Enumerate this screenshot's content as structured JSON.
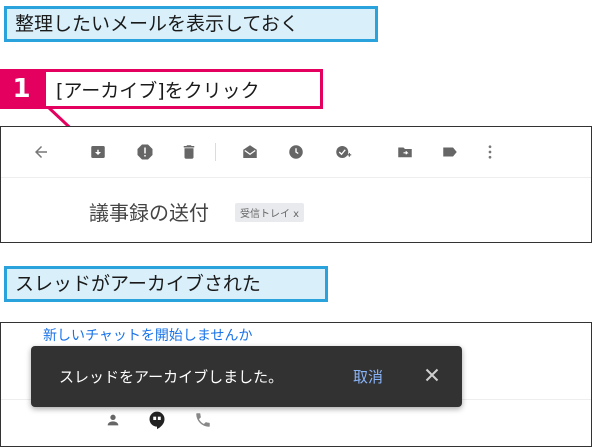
{
  "section1": {
    "heading": "整理したいメールを表示しておく"
  },
  "step": {
    "number": "1",
    "instruction": "[アーカイブ]をクリック"
  },
  "toolbar": {
    "icons": [
      "back-arrow-icon",
      "archive-icon",
      "report-spam-icon",
      "delete-icon",
      "mark-unread-icon",
      "snooze-icon",
      "add-to-tasks-icon",
      "move-to-icon",
      "labels-icon",
      "more-options-icon"
    ]
  },
  "email": {
    "subject": "議事録の送付",
    "label_chip": "受信トレイ x"
  },
  "section2": {
    "heading": "スレッドがアーカイブされた"
  },
  "chat": {
    "link_text": "新しいチャットを開始しませんか"
  },
  "toast": {
    "message": "スレッドをアーカイブしました。",
    "undo_label": "取消"
  },
  "bottom_bar": {
    "icons": [
      "contacts-icon",
      "hangouts-icon",
      "phone-icon"
    ]
  },
  "colors": {
    "accent_blue": "#2aa3dc",
    "accent_magenta": "#e3005e",
    "toast_bg": "#323232",
    "link_blue": "#8ab4f8"
  }
}
